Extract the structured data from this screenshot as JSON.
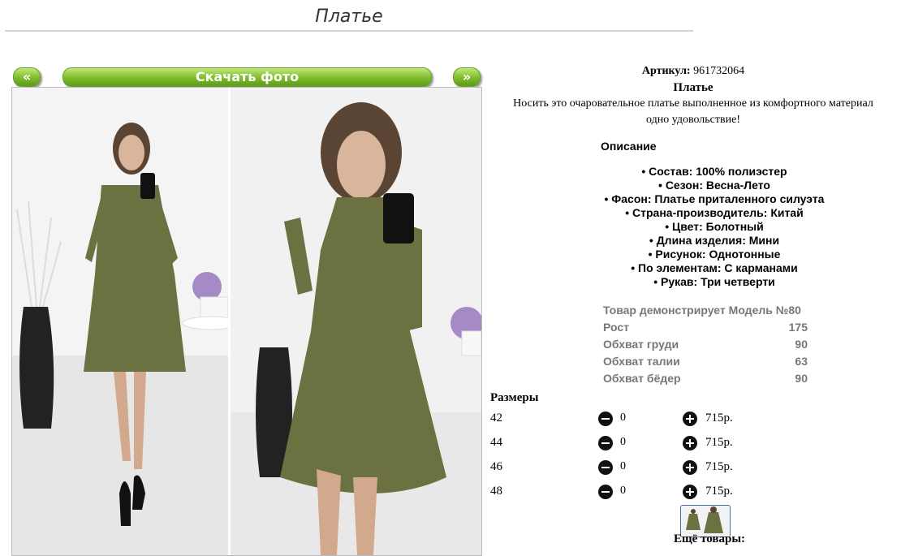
{
  "header": {
    "title": "Платье"
  },
  "gallery": {
    "prev_label": "«",
    "next_label": "»",
    "download_label": "Скачать фото"
  },
  "product": {
    "article_label": "Артикул:",
    "article_value": "961732064",
    "name": "Платье",
    "desc_line1": "Носить это очаровательное платье выполненное из комфортного материал",
    "desc_line2": "одно удовольствие!",
    "description_heading": "Описание",
    "specs": [
      "• Состав: 100% полиэстер",
      "• Сезон: Весна-Лето",
      "• Фасон: Платье приталенного силуэта",
      "• Страна-производитель: Китай",
      "• Цвет: Болотный",
      "• Длина изделия: Мини",
      "• Рисунок: Однотонные",
      "• По элементам: С карманами",
      "• Рукав: Три четверти"
    ],
    "model": {
      "heading": "Товар демонстрирует Модель №80",
      "rows": [
        {
          "label": "Рост",
          "value": "175"
        },
        {
          "label": "Обхват груди",
          "value": "90"
        },
        {
          "label": "Обхват талии",
          "value": "63"
        },
        {
          "label": "Обхват бёдер",
          "value": "90"
        }
      ]
    }
  },
  "sizes": {
    "heading": "Размеры",
    "rows": [
      {
        "size": "42",
        "qty": "0",
        "price": "715р."
      },
      {
        "size": "44",
        "qty": "0",
        "price": "715р."
      },
      {
        "size": "46",
        "qty": "0",
        "price": "715р."
      },
      {
        "size": "48",
        "qty": "0",
        "price": "715р."
      }
    ]
  },
  "more": {
    "heading": "Ещё товары:"
  },
  "colors": {
    "button_green": "#7cbc2a",
    "dress": "#6b7140",
    "link_green": "#1a8a1a"
  }
}
